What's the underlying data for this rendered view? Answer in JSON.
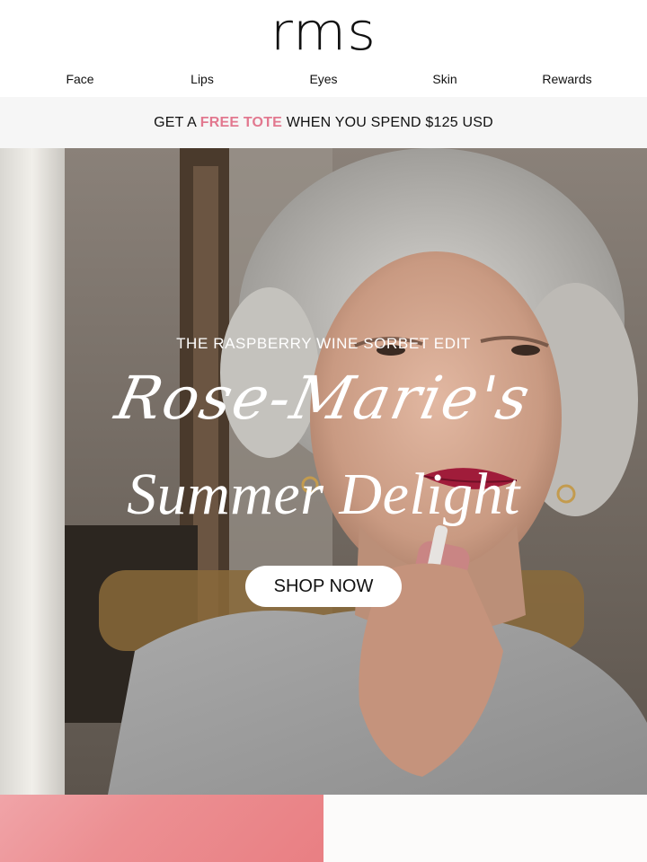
{
  "header": {
    "logo": "rms",
    "nav": [
      {
        "label": "Face"
      },
      {
        "label": "Lips"
      },
      {
        "label": "Eyes"
      },
      {
        "label": "Skin"
      },
      {
        "label": "Rewards"
      }
    ]
  },
  "promo": {
    "prefix": "GET A ",
    "highlight": "FREE TOTE",
    "suffix": " WHEN YOU SPEND $125 USD",
    "highlight_color": "#e2788f"
  },
  "hero": {
    "eyebrow": "THE RASPBERRY WINE SORBET EDIT",
    "script_title": "Rose-Marie's",
    "serif_title": "Summer Delight",
    "cta_label": "SHOP NOW"
  },
  "colors": {
    "accent_pink": "#e2788f",
    "promo_background": "#f6f6f6"
  }
}
